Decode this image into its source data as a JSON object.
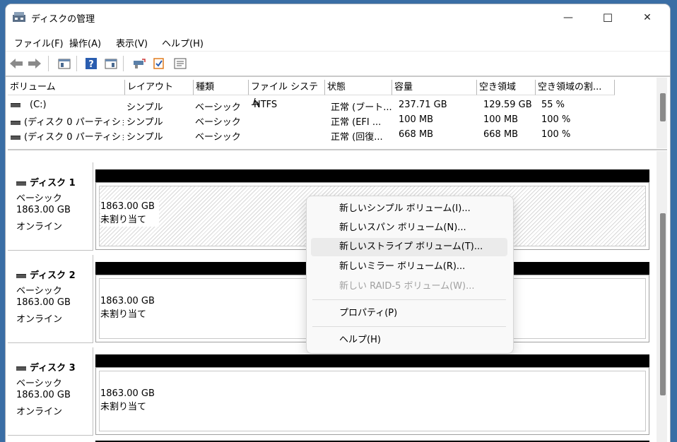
{
  "window": {
    "title": "ディスクの管理",
    "minimize_glyph": "—",
    "maximize_glyph": "☐",
    "close_glyph": "✕"
  },
  "menu": [
    {
      "label": "ファイル(F)"
    },
    {
      "label": "操作(A)"
    },
    {
      "label": "表示(V)"
    },
    {
      "label": "ヘルプ(H)"
    }
  ],
  "toolbar": {
    "icons": [
      "back-arrow-icon",
      "forward-arrow-icon",
      "console-tree-icon",
      "help-icon",
      "action-pane-icon",
      "connect-icon",
      "checklist-icon",
      "properties-icon"
    ]
  },
  "volume_list": {
    "columns": [
      "ボリューム",
      "レイアウト",
      "種類",
      "ファイル システム",
      "状態",
      "容量",
      "空き領域",
      "空き領域の割..."
    ],
    "rows": [
      [
        "(C:)",
        "シンプル",
        "ベーシック",
        "NTFS",
        "正常 (ブート...",
        "237.71 GB",
        "129.59 GB",
        "55 %"
      ],
      [
        "(ディスク 0 パーティショ...",
        "シンプル",
        "ベーシック",
        "",
        "正常 (EFI ...",
        "100 MB",
        "100 MB",
        "100 %"
      ],
      [
        "(ディスク 0 パーティショ...",
        "シンプル",
        "ベーシック",
        "",
        "正常 (回復...",
        "668 MB",
        "668 MB",
        "100 %"
      ]
    ]
  },
  "disks": [
    {
      "name": "ディスク 1",
      "type": "ベーシック",
      "size": "1863.00 GB",
      "status": "オンライン",
      "part_size": "1863.00 GB",
      "part_status": "未割り当て",
      "selected": true
    },
    {
      "name": "ディスク 2",
      "type": "ベーシック",
      "size": "1863.00 GB",
      "status": "オンライン",
      "part_size": "1863.00 GB",
      "part_status": "未割り当て",
      "selected": false
    },
    {
      "name": "ディスク 3",
      "type": "ベーシック",
      "size": "1863.00 GB",
      "status": "オンライン",
      "part_size": "1863.00 GB",
      "part_status": "未割り当て",
      "selected": false
    }
  ],
  "context_menu": {
    "items": [
      {
        "label": "新しいシンプル ボリューム(I)...",
        "state": "normal"
      },
      {
        "label": "新しいスパン ボリューム(N)...",
        "state": "normal"
      },
      {
        "label": "新しいストライプ ボリューム(T)...",
        "state": "hover"
      },
      {
        "label": "新しいミラー ボリューム(R)...",
        "state": "normal"
      },
      {
        "label": "新しい RAID-5 ボリューム(W)...",
        "state": "disabled"
      },
      {
        "label": "プロパティ(P)",
        "state": "normal"
      },
      {
        "label": "ヘルプ(H)",
        "state": "normal"
      }
    ]
  }
}
